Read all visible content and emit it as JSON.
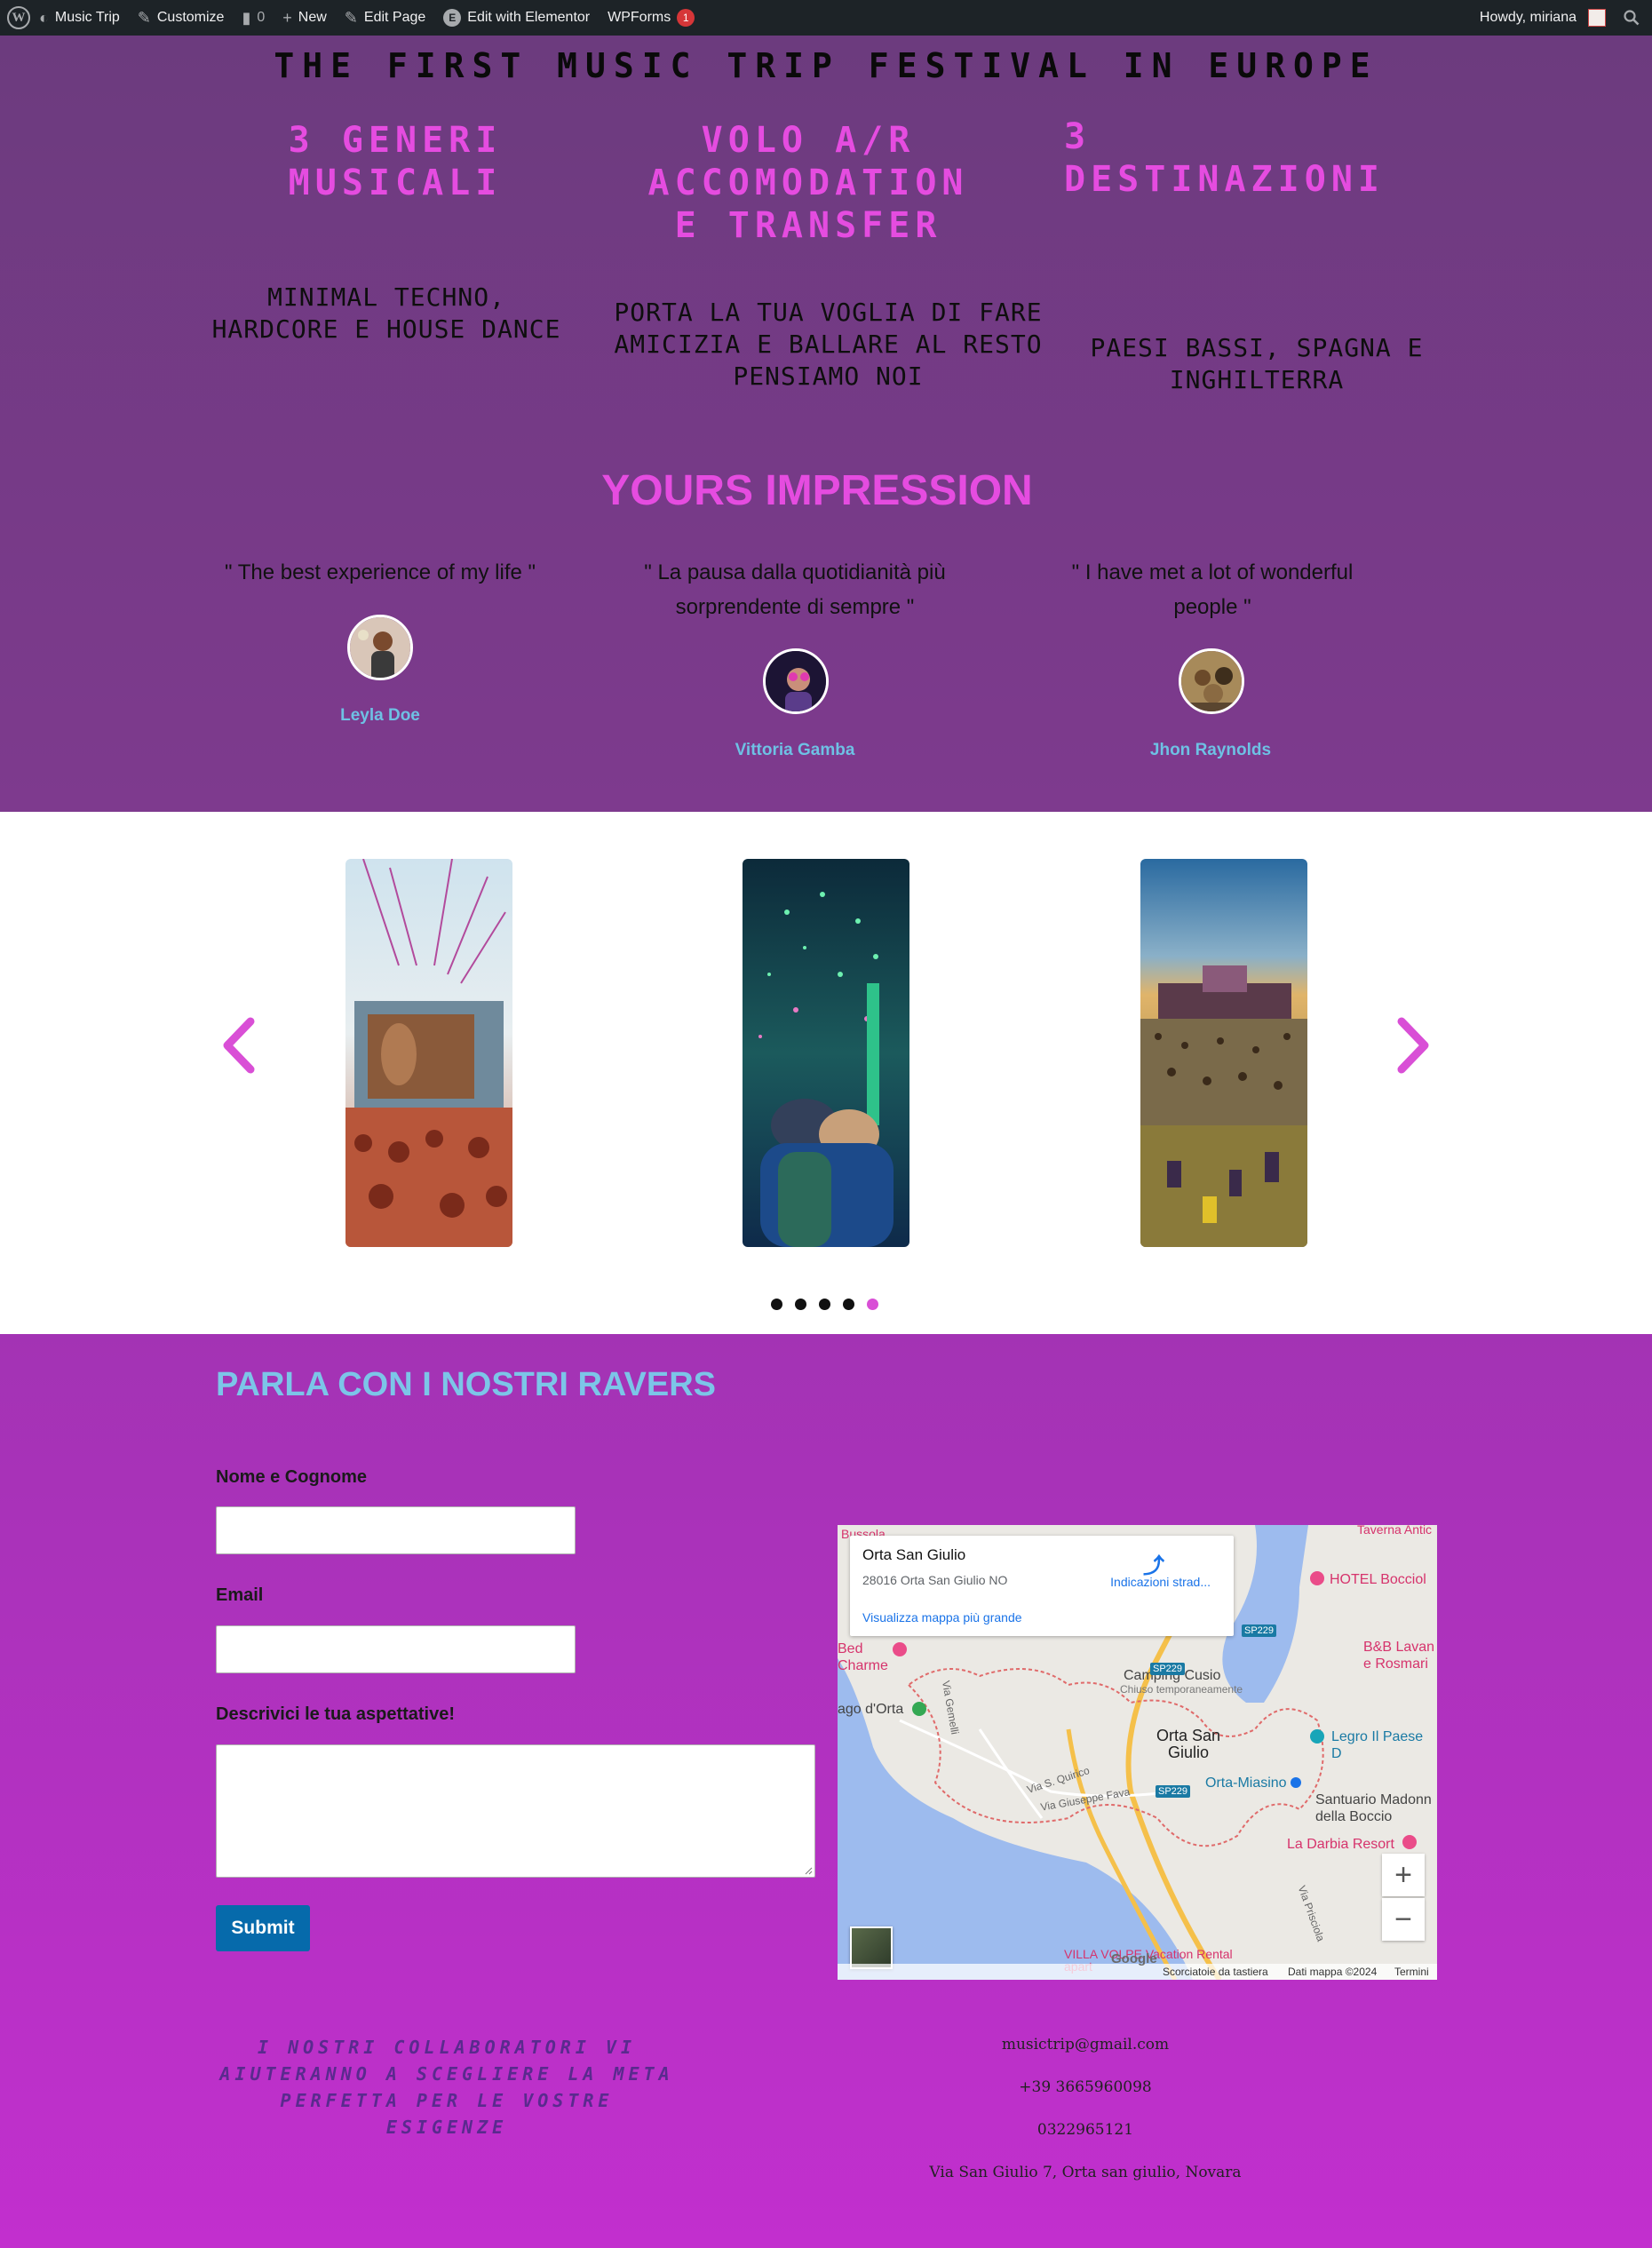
{
  "admin_bar": {
    "site_name": "Music Trip",
    "customize": "Customize",
    "comments": "0",
    "new": "New",
    "edit_page": "Edit Page",
    "elementor": "Edit with Elementor",
    "wpforms": "WPForms",
    "wpforms_count": "1",
    "howdy": "Howdy, miriana"
  },
  "hero": {
    "title": "THE FIRST MUSIC TRIP FESTIVAL IN EUROPE",
    "features": [
      {
        "heading_lines": [
          "3 GENERI",
          "MUSICALI"
        ],
        "text_lines": [
          "MINIMAL TECHNO,",
          "HARDCORE E HOUSE DANCE"
        ]
      },
      {
        "heading_lines": [
          "VOLO A/R",
          "ACCOMODATION",
          "E TRANSFER"
        ],
        "text_lines": [
          "PORTA LA TUA VOGLIA DI FARE",
          "AMICIZIA E BALLARE AL RESTO",
          "PENSIAMO NOI"
        ]
      },
      {
        "heading_lines": [
          "3",
          "DESTINAZIONI"
        ],
        "text_lines": [
          "PAESI BASSI, SPAGNA E",
          "INGHILTERRA"
        ]
      }
    ]
  },
  "impressions": {
    "title": "YOURS IMPRESSION",
    "items": [
      {
        "quote_lines": [
          "\" The best experience of my life \""
        ],
        "name": "Leyla Doe"
      },
      {
        "quote_lines": [
          "\" La pausa dalla quotidianità più",
          "sorprendente di sempre \""
        ],
        "name": "Vittoria Gamba"
      },
      {
        "quote_lines": [
          "\" I have met a lot of wonderful",
          "people \""
        ],
        "name": "Jhon Raynolds"
      }
    ]
  },
  "carousel": {
    "prev_icon": "chevron-left",
    "next_icon": "chevron-right",
    "dot_count": 5,
    "active_dot": 5
  },
  "contact": {
    "title": "PARLA CON I NOSTRI RAVERS",
    "form": {
      "name_label": "Nome e Cognome",
      "email_label": "Email",
      "message_label": "Descrivici le tua aspettative!",
      "submit_label": "Submit"
    },
    "map": {
      "place_title": "Orta San Giulio",
      "place_address": "28016 Orta San Giulio NO",
      "directions": "Indicazioni strad...",
      "larger_map": "Visualizza mappa più grande",
      "labels": {
        "town": "Orta San Giulio",
        "camping": "Camping Cusio",
        "camping_status": "Chiuso temporaneamente",
        "hotel": "HOTEL Bocciol",
        "bb": "B&B Lavan e Rosmari",
        "legro": "Legro Il Paese D",
        "orta_miasino": "Orta-Miasino",
        "santuario": "Santuario Madonn della Boccio",
        "darbia": "La Darbia Resort",
        "villa": "VILLA VOLPE Vacation Rental apart",
        "bed": "Bed Charme",
        "lago": "ago d'Orta",
        "bussola": "Bussola",
        "taverna": "Taverna Antic",
        "sp229_a": "SP229",
        "sp229_b": "SP229",
        "sp229_c": "SP229",
        "via_quirico": "Via S. Quirico",
        "via_fava": "Via Giuseppe Fava",
        "via_gemelli": "Via Gemelli",
        "via_prisciola": "Via Prisciola"
      },
      "footer": {
        "google": "Google",
        "shortcuts": "Scorciatoie da tastiera",
        "data": "Dati mappa ©2024",
        "terms": "Termini"
      }
    },
    "tagline_lines": [
      "I NOSTRI COLLABORATORI VI",
      "AIUTERANNO A SCEGLIERE LA META",
      "PERFETTA PER LE VOSTRE ESIGENZE"
    ],
    "info": {
      "email": "musictrip@gmail.com",
      "phone1": "+39 3665960098",
      "phone2": "0322965121",
      "address": "Via San Giulio 7, Orta san giulio, Novara"
    }
  },
  "colors": {
    "accent_pink": "#e54ce0",
    "light_blue": "#6ec1e4",
    "admin_bar": "#1d2327",
    "submit": "#066aab"
  }
}
